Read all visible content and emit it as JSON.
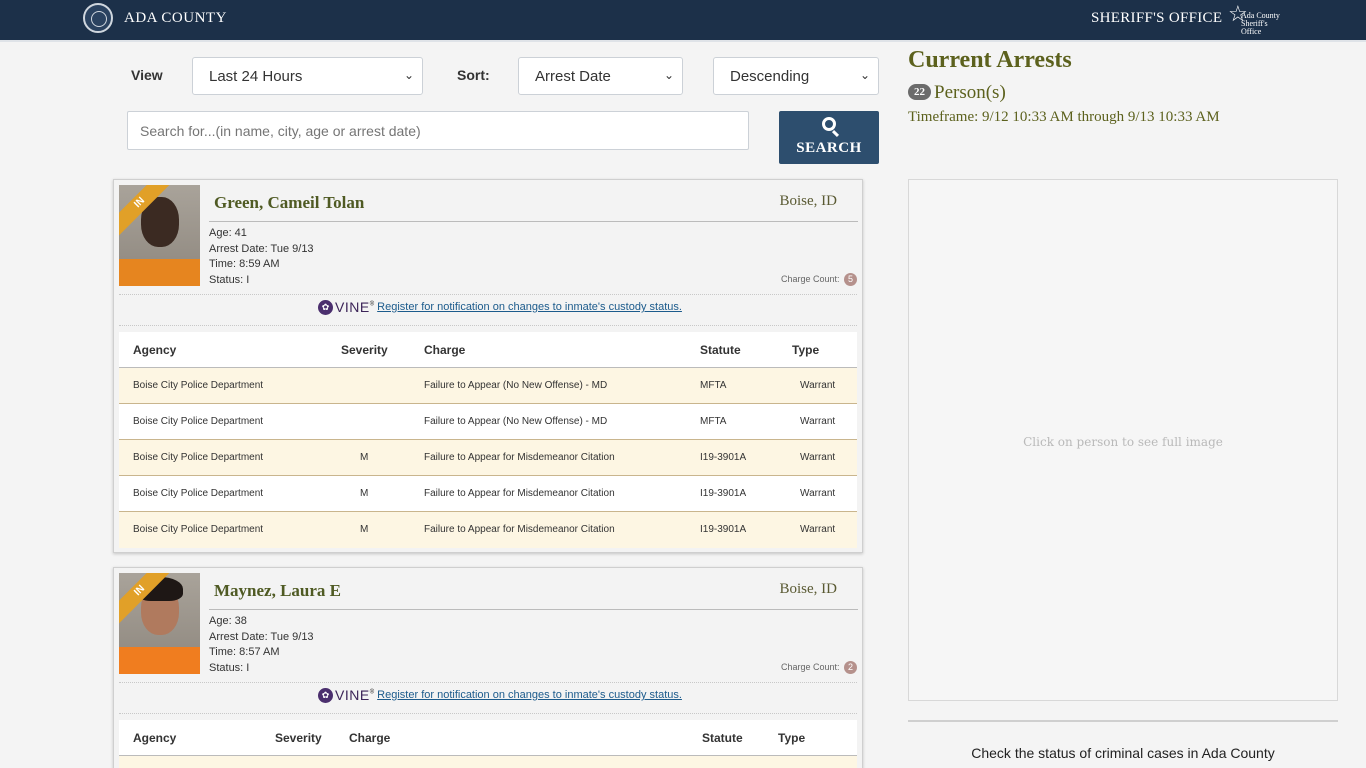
{
  "header": {
    "county_title": "ADA COUNTY",
    "office_title": "SHERIFF'S OFFICE",
    "logo_text": "Ada County Sheriff's Office"
  },
  "controls": {
    "view_label": "View",
    "view_value": "Last 24 Hours",
    "sort_label": "Sort:",
    "sort_value": "Arrest Date",
    "order_value": "Descending",
    "search_placeholder": "Search for...(in name, city, age or arrest date)",
    "search_button": "SEARCH"
  },
  "arrests": [
    {
      "status_ribbon": "IN",
      "name": "Green, Cameil Tolan",
      "city": "Boise, ID",
      "age": "Age: 41",
      "arrest_date": "Arrest Date: Tue 9/13",
      "time": "Time: 8:59 AM",
      "status": "Status: I",
      "charge_count_label": "Charge Count:",
      "charge_count": "5",
      "vine_label": "VINE",
      "vine_link": " Register for notification on changes to inmate's custody status.",
      "headers": {
        "agency": "Agency",
        "severity": "Severity",
        "charge": "Charge",
        "statute": "Statute",
        "type": "Type"
      },
      "charges": [
        {
          "agency": "Boise City Police Department",
          "severity": "",
          "charge": "Failure to Appear (No New Offense) - MD",
          "statute": "MFTA",
          "type": "Warrant"
        },
        {
          "agency": "Boise City Police Department",
          "severity": "",
          "charge": "Failure to Appear (No New Offense) - MD",
          "statute": "MFTA",
          "type": "Warrant"
        },
        {
          "agency": "Boise City Police Department",
          "severity": "M",
          "charge": "Failure to Appear for Misdemeanor Citation",
          "statute": "I19-3901A",
          "type": "Warrant"
        },
        {
          "agency": "Boise City Police Department",
          "severity": "M",
          "charge": "Failure to Appear for Misdemeanor Citation",
          "statute": "I19-3901A",
          "type": "Warrant"
        },
        {
          "agency": "Boise City Police Department",
          "severity": "M",
          "charge": "Failure to Appear for Misdemeanor Citation",
          "statute": "I19-3901A",
          "type": "Warrant"
        }
      ]
    },
    {
      "status_ribbon": "IN",
      "name": "Maynez, Laura E",
      "city": "Boise, ID",
      "age": "Age: 38",
      "arrest_date": "Arrest Date: Tue 9/13",
      "time": "Time: 8:57 AM",
      "status": "Status: I",
      "charge_count_label": "Charge Count:",
      "charge_count": "2",
      "vine_label": "VINE",
      "vine_link": " Register for notification on changes to inmate's custody status.",
      "headers": {
        "agency": "Agency",
        "severity": "Severity",
        "charge": "Charge",
        "statute": "Statute",
        "type": "Type"
      }
    }
  ],
  "summary": {
    "title": "Current Arrests",
    "person_count": "22",
    "person_label": "Person(s)",
    "timeframe": "Timeframe: 9/12 10:33 AM through 9/13 10:33 AM",
    "image_hint": "Click on person to see full image",
    "case_status_text": "Check the status of criminal cases in Ada County"
  },
  "colors": {
    "header_bg": "#1c3049",
    "title_olive": "#5c611d",
    "ribbon": "#e1a028",
    "search_button": "#2d4e6e",
    "row_alt": "#fdf6e3"
  }
}
